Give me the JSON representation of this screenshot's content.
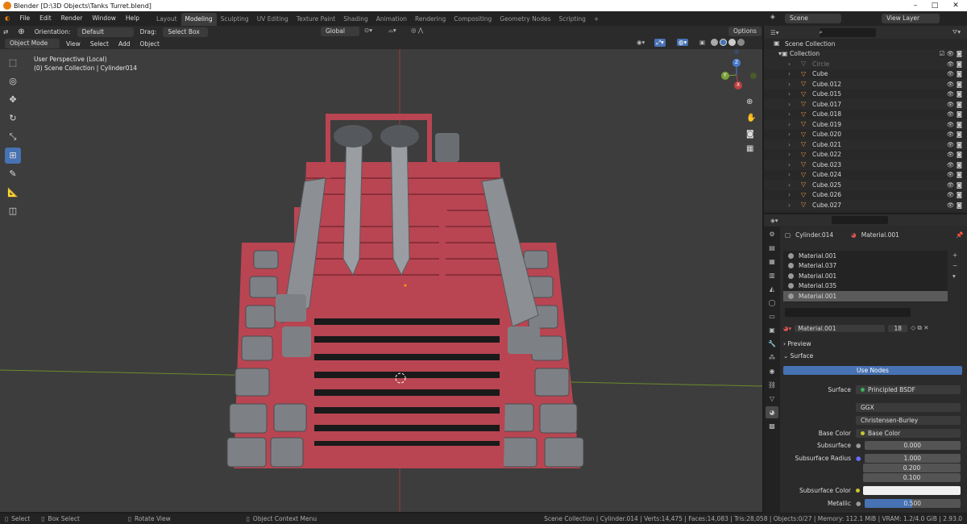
{
  "title": "Blender [D:\\3D Objects\\Tanks Turret.blend]",
  "menu": [
    "File",
    "Edit",
    "Render",
    "Window",
    "Help"
  ],
  "workspaces": [
    "Layout",
    "Modeling",
    "Sculpting",
    "UV Editing",
    "Texture Paint",
    "Shading",
    "Animation",
    "Rendering",
    "Compositing",
    "Geometry Nodes",
    "Scripting"
  ],
  "active_workspace": "Modeling",
  "add_tab": "+",
  "scene": "Scene",
  "view_layer": "View Layer",
  "header": {
    "orientation_label": "Orientation:",
    "orientation_value": "Default",
    "drag_label": "Drag:",
    "drag_value": "Select Box",
    "transform": "Global",
    "options": "Options"
  },
  "header2": {
    "mode": "Object Mode",
    "menus": [
      "View",
      "Select",
      "Add",
      "Object"
    ]
  },
  "viewport": {
    "line1": "User Perspective (Local)",
    "line2": "(0) Scene Collection | Cylinder014",
    "gizmo": {
      "x": "X",
      "y": "Y",
      "z": "Z"
    }
  },
  "outliner": {
    "root": "Scene Collection",
    "collection": "Collection",
    "items": [
      "Circle",
      "Cube",
      "Cube.012",
      "Cube.015",
      "Cube.017",
      "Cube.018",
      "Cube.019",
      "Cube.020",
      "Cube.021",
      "Cube.022",
      "Cube.023",
      "Cube.024",
      "Cube.025",
      "Cube.026",
      "Cube.027"
    ]
  },
  "properties": {
    "object": "Cylinder.014",
    "material": "Material.001",
    "slots": [
      "Material.001",
      "Material.037",
      "Material.001",
      "Material.035",
      "Material.001"
    ],
    "selected_slot": 4,
    "datablock": "Material.001",
    "users": "18",
    "preview": "Preview",
    "surface_panel": "Surface",
    "use_nodes": "Use Nodes",
    "surface_label": "Surface",
    "surface_value": "Principled BSDF",
    "distribution": "GGX",
    "subsurface_method": "Christensen-Burley",
    "base_color_label": "Base Color",
    "base_color_value": "Base Color",
    "subsurface_label": "Subsurface",
    "subsurface_value": "0.000",
    "subsurface_radius_label": "Subsurface Radius",
    "radius": [
      "1.000",
      "0.200",
      "0.100"
    ],
    "subsurface_color_label": "Subsurface Color",
    "metallic_label": "Metallic",
    "metallic_value": "0.500",
    "metallic_fraction": 0.5
  },
  "status": {
    "select": "Select",
    "box_select": "Box Select",
    "rotate": "Rotate View",
    "context": "Object Context Menu",
    "stats": "Scene Collection | Cylinder.014 | Verts:14,475 | Faces:14,083 | Tris:28,058 | Objects:0/27 | Memory: 112.1 MiB | VRAM: 1.2/4.0 GiB | 2.93.0"
  },
  "colors": {
    "accent": "#4772b3",
    "tank_red": "#b94552",
    "tank_grey": "#7d8186",
    "grid_red": "#9c3b3b",
    "grid_green": "#6c8a2c"
  }
}
